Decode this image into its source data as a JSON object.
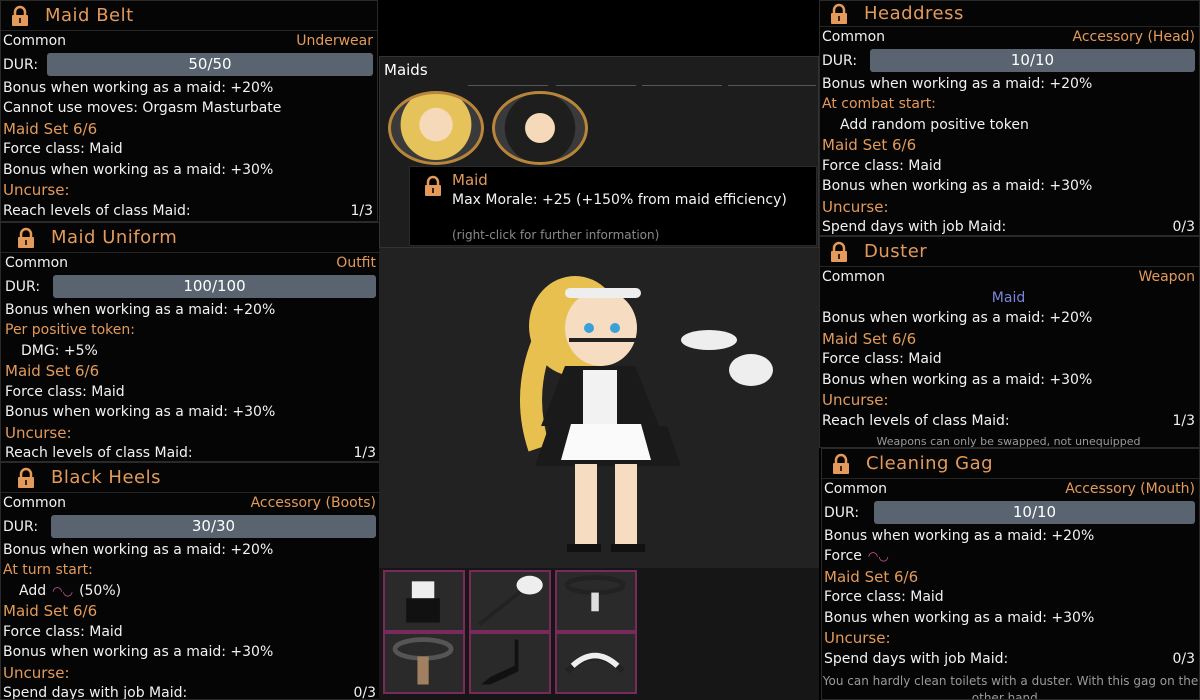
{
  "maid_belt": {
    "title": "Maid Belt",
    "rarity": "Common",
    "slot": "Underwear",
    "dur_label": "DUR:",
    "dur": "50/50",
    "lines": [
      "Bonus when working as a maid: +20%",
      "Cannot use moves: Orgasm Masturbate"
    ],
    "set_title": "Maid Set 6/6",
    "set_lines": [
      "Force class: Maid",
      "Bonus when working as a maid: +30%"
    ],
    "uncurse_title": "Uncurse:",
    "uncurse_text": "Reach levels of class Maid:",
    "uncurse_progress": "1/3"
  },
  "maid_uniform": {
    "title": "Maid Uniform",
    "rarity": "Common",
    "slot": "Outfit",
    "dur_label": "DUR:",
    "dur": "100/100",
    "line1": "Bonus when working as a maid: +20%",
    "token_title": "Per positive token:",
    "token_line": "DMG: +5%",
    "set_title": "Maid Set 6/6",
    "set_lines": [
      "Force class: Maid",
      "Bonus when working as a maid: +30%"
    ],
    "uncurse_title": "Uncurse:",
    "uncurse_text": "Reach levels of class Maid:",
    "uncurse_progress": "1/3"
  },
  "black_heels": {
    "title": "Black Heels",
    "rarity": "Common",
    "slot": "Accessory (Boots)",
    "dur_label": "DUR:",
    "dur": "30/30",
    "line1": "Bonus when working as a maid: +20%",
    "turn_title": "At turn start:",
    "turn_line": "Add",
    "turn_pct": "(50%)",
    "set_title": "Maid Set 6/6",
    "set_lines": [
      "Force class: Maid",
      "Bonus when working as a maid: +30%"
    ],
    "uncurse_title": "Uncurse:",
    "uncurse_text": "Spend days with job Maid:",
    "uncurse_progress": "0/3"
  },
  "headdress": {
    "title": "Headdress",
    "rarity": "Common",
    "slot": "Accessory (Head)",
    "dur_label": "DUR:",
    "dur": "10/10",
    "line1": "Bonus when working as a maid: +20%",
    "combat_title": "At combat start:",
    "combat_line": "Add random positive token",
    "set_title": "Maid Set 6/6",
    "set_lines": [
      "Force class: Maid",
      "Bonus when working as a maid: +30%"
    ],
    "uncurse_title": "Uncurse:",
    "uncurse_text": "Spend days with job Maid:",
    "uncurse_progress": "0/3"
  },
  "duster": {
    "title": "Duster",
    "rarity": "Common",
    "slot": "Weapon",
    "class_tag": "Maid",
    "line1": "Bonus when working as a maid: +20%",
    "set_title": "Maid Set 6/6",
    "set_lines": [
      "Force class: Maid",
      "Bonus when working as a maid: +30%"
    ],
    "uncurse_title": "Uncurse:",
    "uncurse_text": "Reach levels of class Maid:",
    "uncurse_progress": "1/3",
    "note": "Weapons can only be swapped, not unequipped"
  },
  "cleaning_gag": {
    "title": "Cleaning Gag",
    "rarity": "Common",
    "slot": "Accessory (Mouth)",
    "dur_label": "DUR:",
    "dur": "10/10",
    "line1": "Bonus when working as a maid: +20%",
    "force_line": "Force",
    "set_title": "Maid Set 6/6",
    "set_lines": [
      "Force class: Maid",
      "Bonus when working as a maid: +30%"
    ],
    "uncurse_title": "Uncurse:",
    "uncurse_text": "Spend days with job Maid:",
    "uncurse_progress": "0/3",
    "flavor": "You can hardly clean toilets with a duster. With this gag on the other hand..."
  },
  "maids": {
    "header": "Maids",
    "tooltip_title": "Maid",
    "tooltip_body": "Max Morale: +25 (+150% from maid efficiency)",
    "tooltip_hint": "(right-click for further information)"
  },
  "colors": {
    "accent": "#e39a5a",
    "bar": "#596470",
    "slot_border": "#7a2a5a",
    "lock": "#e39a5a"
  },
  "icons": [
    "lock-icon",
    "token-icon",
    "maid-portrait",
    "item-slot-icon"
  ]
}
